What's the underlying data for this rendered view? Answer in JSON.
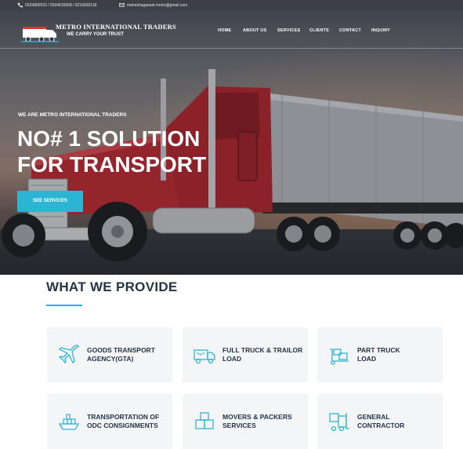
{
  "topbar": {
    "phones": "9334800533 / 9334615508 / 8210692118",
    "email": "maheshagarwal.metro@gmail.com"
  },
  "brand": {
    "name": "METRO INTERNATIONAL TRADERS",
    "tagline": "WE CARRY YOUR TRUST"
  },
  "nav": {
    "items": [
      "HOME",
      "ABOUT US",
      "SERVICES",
      "CLIENTS",
      "CONTACT",
      "INQUIRY"
    ]
  },
  "hero": {
    "subtitle": "WE ARE METRO INTERNATIONAL TRADERS",
    "title_line1": "NO# 1 SOLUTION",
    "title_line2": "FOR TRANSPORT",
    "cta_label": "SEE SERVICES"
  },
  "services": {
    "heading": "WHAT WE PROVIDE",
    "items": [
      {
        "line1": "GOODS TRANSPORT",
        "line2": "AGENCY(GTA)",
        "icon": "airplane-icon"
      },
      {
        "line1": "FULL TRUCK & TRAILOR",
        "line2": "LOAD",
        "icon": "delivery-truck-icon"
      },
      {
        "line1": "PART TRUCK",
        "line2": "LOAD",
        "icon": "hand-truck-icon"
      },
      {
        "line1": "TRANSPORTATION OF",
        "line2": "ODC CONSIGNMENTS",
        "icon": "ship-icon"
      },
      {
        "line1": "MOVERS & PACKERS",
        "line2": "SERVICES",
        "icon": "boxes-icon"
      },
      {
        "line1": "GENERAL",
        "line2": "CONTRACTOR",
        "icon": "forklift-icon"
      }
    ]
  },
  "colors": {
    "accent": "#2bb5d3",
    "heading": "#233446",
    "card_bg": "#f4f5f7",
    "truck_red": "#b3262c"
  }
}
